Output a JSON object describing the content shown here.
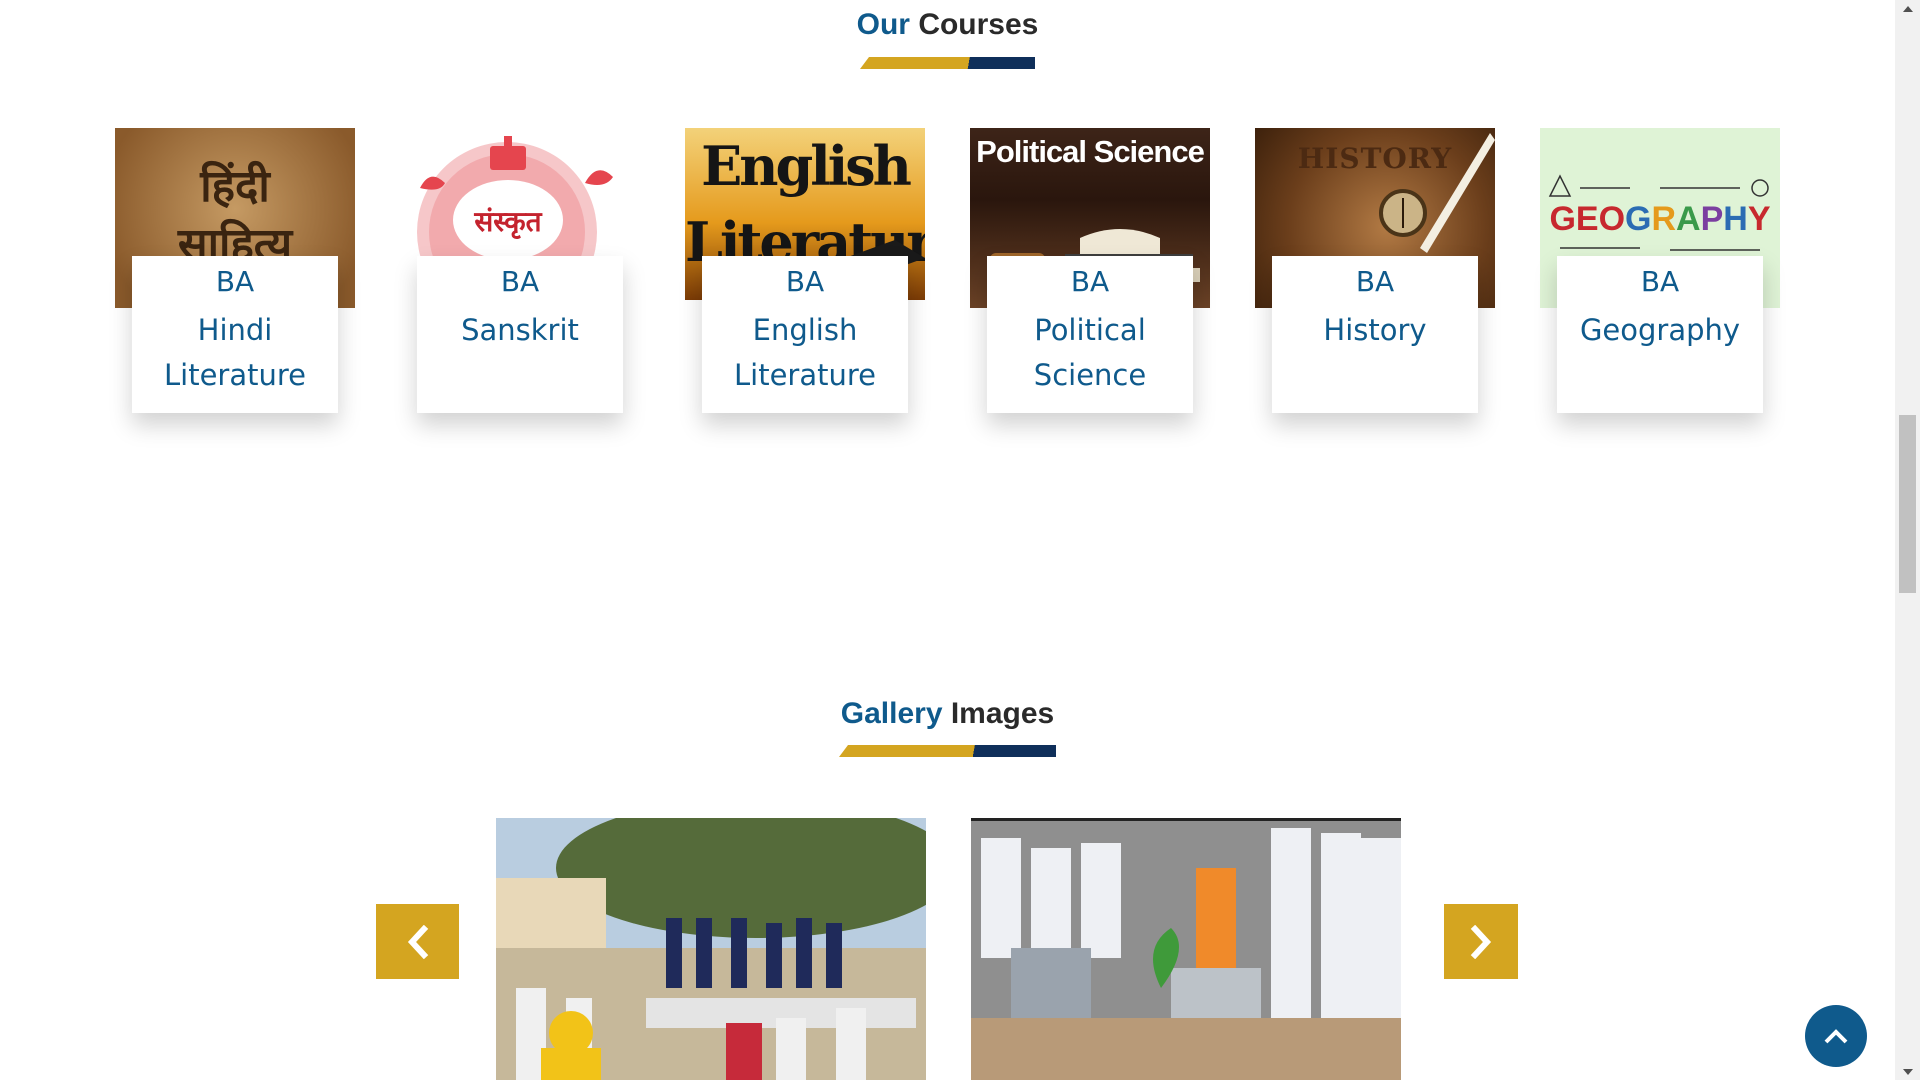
{
  "courses_section": {
    "title_accent": "Our",
    "title_rest": "Courses"
  },
  "courses": [
    {
      "degree": "BA",
      "name": "Hindi Literature",
      "thumb_text": "हिंदी साहित्य"
    },
    {
      "degree": "BA",
      "name": "Sanskrit",
      "thumb_text": "संस्कृत"
    },
    {
      "degree": "BA",
      "name": "English Literature",
      "thumb_text": "English Literature"
    },
    {
      "degree": "BA",
      "name": "Political Science",
      "thumb_text": "Political Science"
    },
    {
      "degree": "BA",
      "name": "History",
      "thumb_text": "HISTORY"
    },
    {
      "degree": "BA",
      "name": "Geography",
      "thumb_text": "GEOGRAPHY"
    }
  ],
  "gallery_section": {
    "title_accent": "Gallery",
    "title_rest": "Images"
  },
  "colors": {
    "accent_blue": "#0f5a8c",
    "accent_gold": "#d4a520",
    "navy": "#0f2f5a"
  },
  "icons": {
    "prev": "chevron-left-icon",
    "next": "chevron-right-icon",
    "scroll_top": "chevron-up-icon"
  }
}
